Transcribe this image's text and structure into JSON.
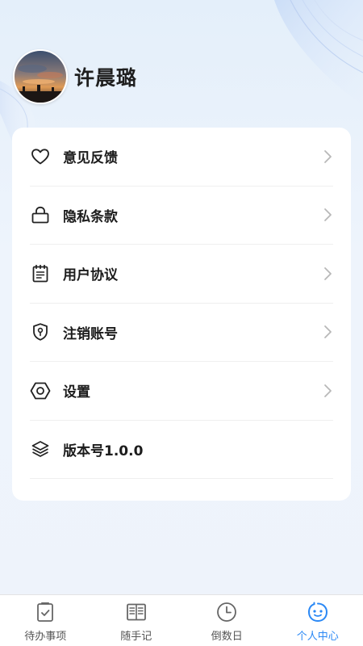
{
  "profile": {
    "username": "许晨璐"
  },
  "menu": {
    "items": [
      {
        "label": "意见反馈",
        "icon": "heart-icon",
        "has_arrow": true
      },
      {
        "label": "隐私条款",
        "icon": "lock-icon",
        "has_arrow": true
      },
      {
        "label": "用户协议",
        "icon": "notepad-icon",
        "has_arrow": true
      },
      {
        "label": "注销账号",
        "icon": "shield-key-icon",
        "has_arrow": true
      },
      {
        "label": "设置",
        "icon": "hexagon-settings-icon",
        "has_arrow": true
      },
      {
        "label": "版本号1.0.0",
        "icon": "layers-icon",
        "has_arrow": false
      }
    ]
  },
  "tabbar": {
    "tabs": [
      {
        "label": "待办事项",
        "icon": "todo-clipboard-icon",
        "active": false
      },
      {
        "label": "随手记",
        "icon": "open-book-icon",
        "active": false
      },
      {
        "label": "倒数日",
        "icon": "clock-icon",
        "active": false
      },
      {
        "label": "个人中心",
        "icon": "smiley-face-icon",
        "active": true
      }
    ]
  },
  "colors": {
    "accent": "#2a88f5",
    "text": "#1c1c1c",
    "inactive_tab": "#555555",
    "background": "#eef3fb"
  }
}
